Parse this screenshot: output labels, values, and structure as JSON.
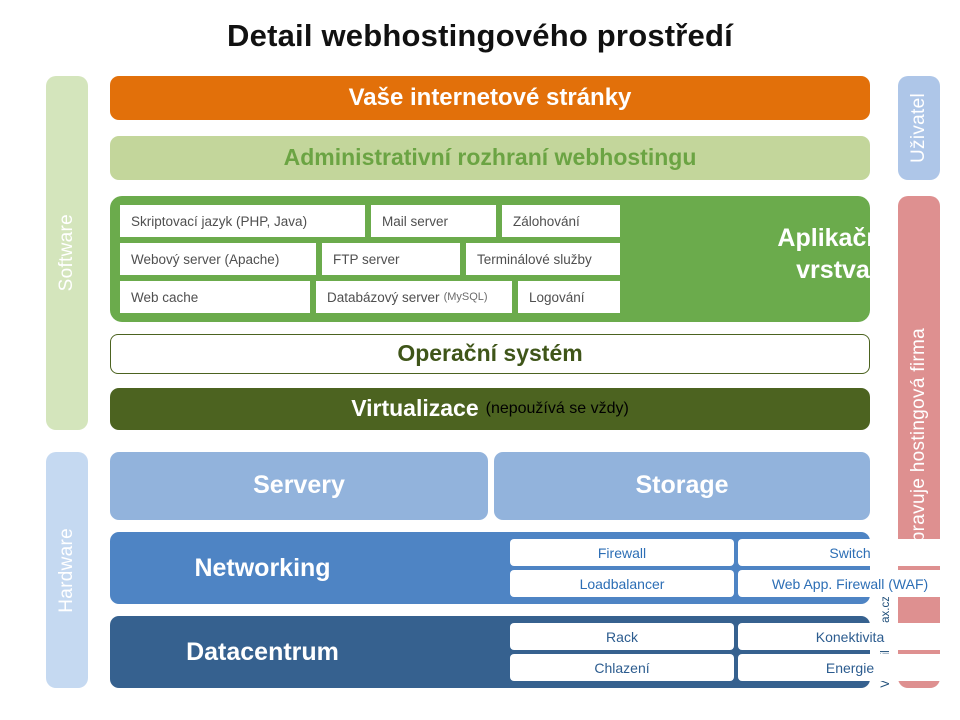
{
  "title": "Detail webhostingového prostředí",
  "left_rails": [
    {
      "label": "Software",
      "color": "#D4E5BC"
    },
    {
      "label": "Hardware",
      "color": "#C5D9F1"
    }
  ],
  "right_rails": [
    {
      "label": "Uživatel",
      "color": "#AEC6E8"
    },
    {
      "label": "Spravuje hostingová firma",
      "color": "#DE9090"
    }
  ],
  "credit": "Vytvořil wpmax.cz",
  "layers": {
    "websites": {
      "label": "Vaše internetové stránky",
      "color": "#E2700A"
    },
    "admin": {
      "label": "Administrativní rozhraní webhostingu",
      "color": "#C3D69B"
    },
    "application": {
      "title_line1": "Aplikační",
      "title_line2": "vrstva",
      "color": "#6BAB4C",
      "rows": [
        [
          {
            "label": "Skriptovací jazyk (PHP, Java)",
            "sub": "",
            "flex": 245
          },
          {
            "label": "Mail server",
            "sub": "",
            "flex": 125
          },
          {
            "label": "Zálohování",
            "sub": "",
            "flex": 118
          }
        ],
        [
          {
            "label": "Webový server (Apache)",
            "sub": "",
            "flex": 196
          },
          {
            "label": "FTP server",
            "sub": "",
            "flex": 138
          },
          {
            "label": "Terminálové služby",
            "sub": "",
            "flex": 154
          }
        ],
        [
          {
            "label": "Web cache",
            "sub": "",
            "flex": 190
          },
          {
            "label": "Databázový server",
            "sub": "(MySQL)",
            "flex": 196
          },
          {
            "label": "Logování",
            "sub": "",
            "flex": 102
          }
        ]
      ]
    },
    "os": {
      "label": "Operační systém",
      "color": "#4C6320"
    },
    "virtualization": {
      "label": "Virtualizace",
      "note": "(nepoužívá se vždy)",
      "color": "#4C6320"
    },
    "servers": {
      "label": "Servery",
      "color": "#92B3DC"
    },
    "storage": {
      "label": "Storage",
      "color": "#92B3DC"
    },
    "networking": {
      "label": "Networking",
      "color": "#4E84C4",
      "items": [
        [
          "Firewall",
          "Switch"
        ],
        [
          "Loadbalancer",
          "Web  App. Firewall (WAF)"
        ]
      ]
    },
    "datacenter": {
      "label": "Datacentrum",
      "color": "#36618F",
      "items": [
        [
          "Rack",
          "Konektivita"
        ],
        [
          "Chlazení",
          "Energie"
        ]
      ]
    }
  }
}
